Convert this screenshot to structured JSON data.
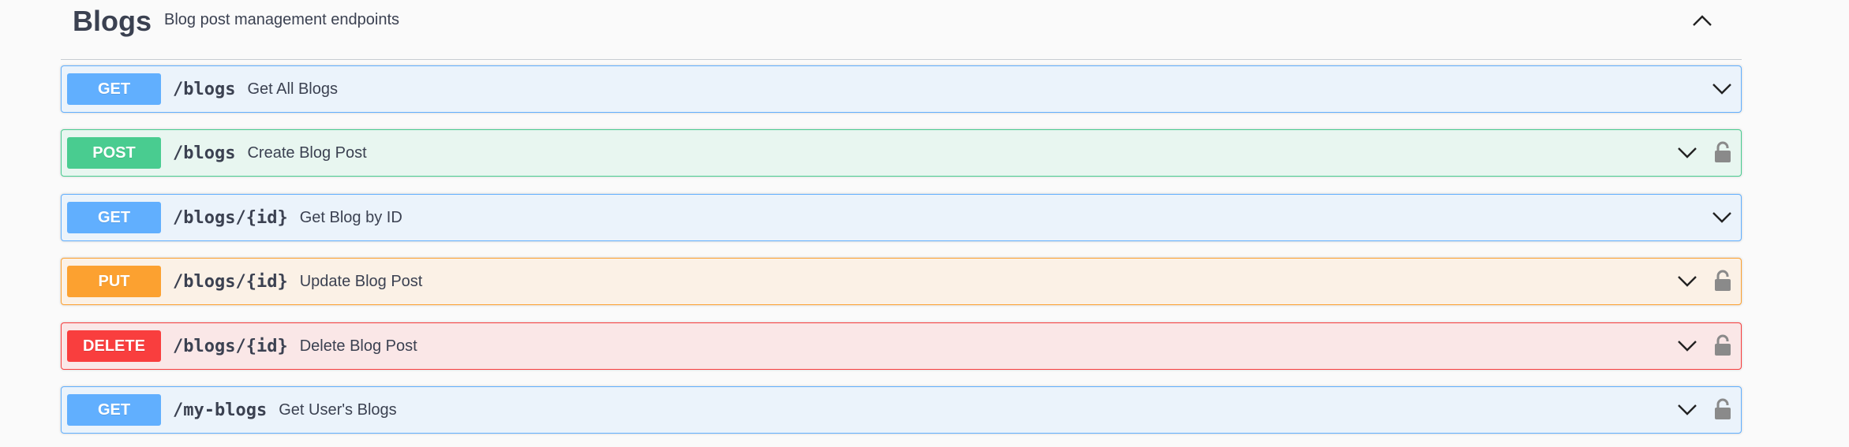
{
  "tag": {
    "name": "Blogs",
    "description": "Blog post management endpoints"
  },
  "colors": {
    "get": "#61affe",
    "post": "#49cc90",
    "put": "#fca130",
    "delete": "#f93e3e",
    "text": "#3b4151"
  },
  "operations": [
    {
      "method": "GET",
      "path": "/blogs",
      "summary": "Get All Blogs",
      "locked": false,
      "icons": [
        "chevron-down-icon"
      ]
    },
    {
      "method": "POST",
      "path": "/blogs",
      "summary": "Create Blog Post",
      "locked": true,
      "icons": [
        "chevron-down-icon",
        "lock-icon"
      ]
    },
    {
      "method": "GET",
      "path": "/blogs/{id}",
      "summary": "Get Blog by ID",
      "locked": false,
      "icons": [
        "chevron-down-icon"
      ]
    },
    {
      "method": "PUT",
      "path": "/blogs/{id}",
      "summary": "Update Blog Post",
      "locked": true,
      "icons": [
        "chevron-down-icon",
        "lock-icon"
      ]
    },
    {
      "method": "DELETE",
      "path": "/blogs/{id}",
      "summary": "Delete Blog Post",
      "locked": true,
      "icons": [
        "chevron-down-icon",
        "lock-icon"
      ]
    },
    {
      "method": "GET",
      "path": "/my-blogs",
      "summary": "Get User's Blogs",
      "locked": true,
      "icons": [
        "chevron-down-icon",
        "lock-icon"
      ]
    }
  ]
}
